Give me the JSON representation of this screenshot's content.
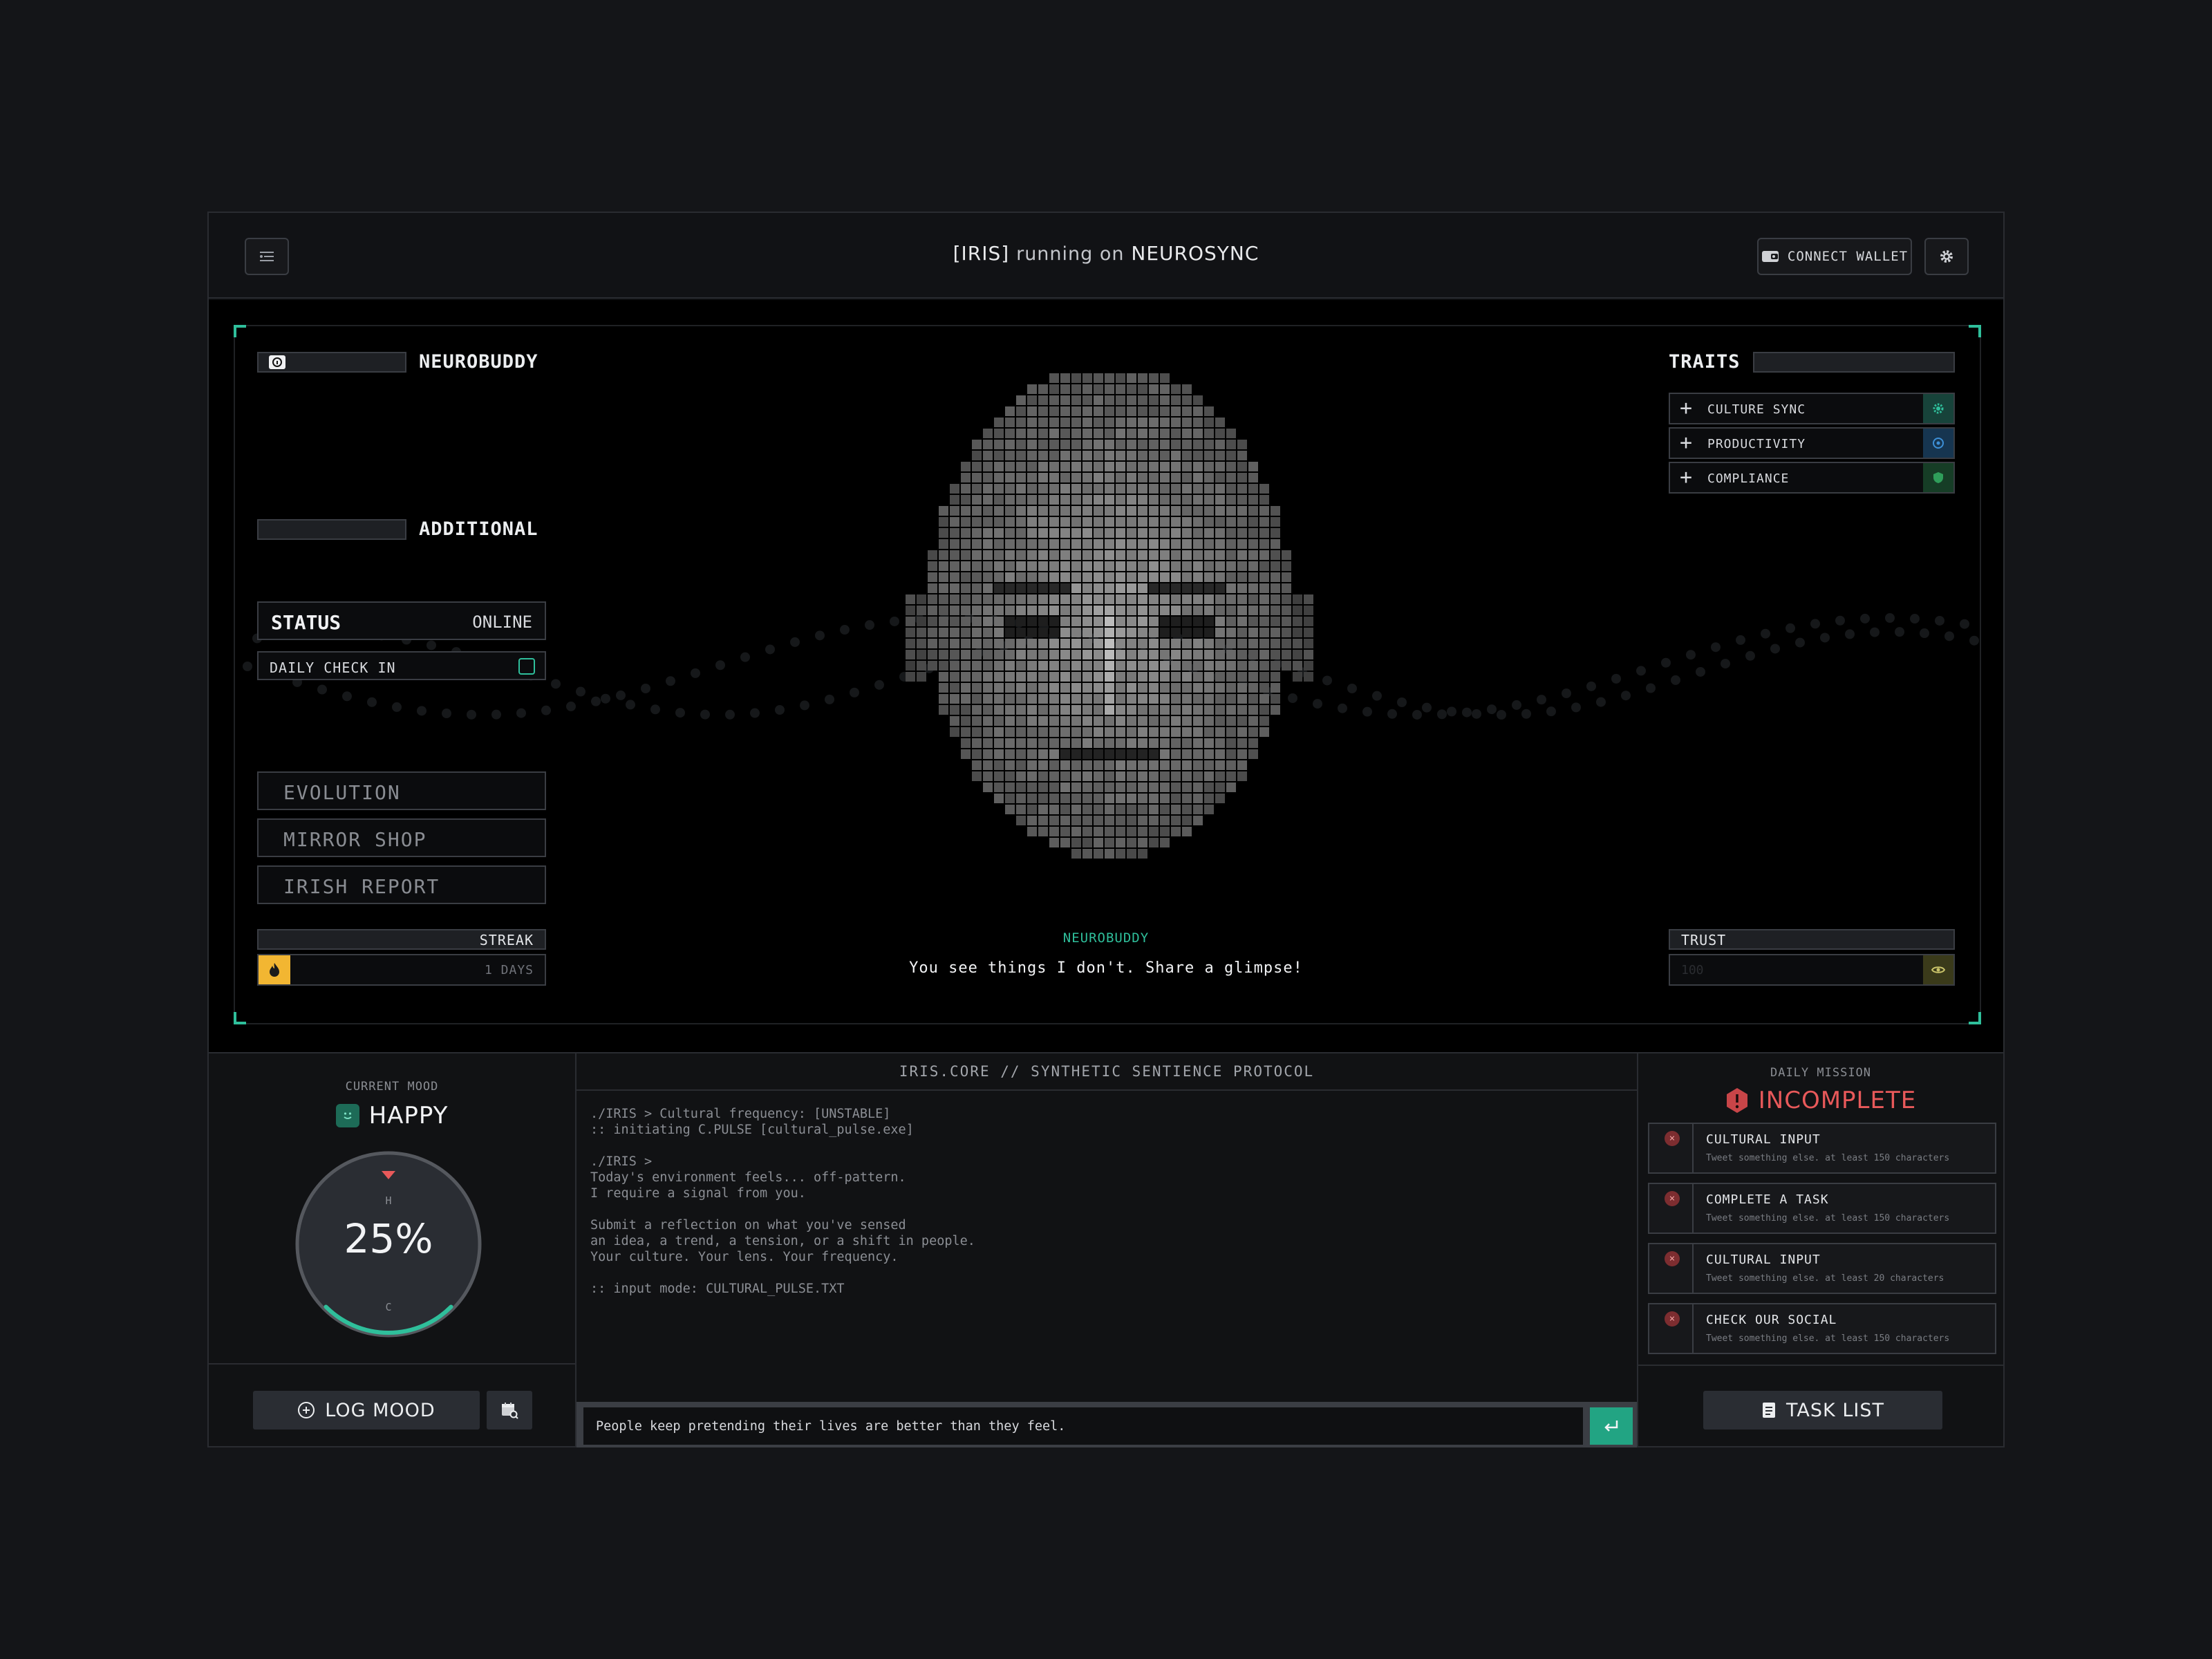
{
  "header": {
    "brand": "[IRIS]",
    "running": "running on",
    "platform": "NEUROSYNC",
    "connect_wallet": "CONNECT WALLET"
  },
  "left": {
    "section_title": "NEUROBUDDY",
    "status_label": "STATUS",
    "status_value": "ONLINE",
    "daily_check_in": "DAILY CHECK IN",
    "additional_title": "ADDITIONAL",
    "additional_items": [
      {
        "label": "EVOLUTION"
      },
      {
        "label": "MIRROR SHOP"
      },
      {
        "label": "IRISH REPORT"
      }
    ],
    "streak_label": "STREAK",
    "streak_value": "1 DAYS"
  },
  "right": {
    "traits_title": "TRAITS",
    "traits": [
      {
        "label": "CULTURE SYNC",
        "icon": "culture-sync-icon",
        "color": "#2fbf9b"
      },
      {
        "label": "PRODUCTIVITY",
        "icon": "productivity-icon",
        "color": "#3d8fd6"
      },
      {
        "label": "COMPLIANCE",
        "icon": "compliance-icon",
        "color": "#2f9e5a"
      }
    ],
    "trust_label": "TRUST",
    "trust_value": "100"
  },
  "center": {
    "speaker": "NEUROBUDDY",
    "message": "You see things I don't. Share a glimpse!"
  },
  "mood": {
    "caption": "CURRENT MOOD",
    "value": "HAPPY",
    "percent_text": "25%",
    "percent": 0.25,
    "top_label": "H",
    "bottom_label": "C",
    "log_button": "LOG MOOD",
    "accent": "#2fbf9b"
  },
  "terminal": {
    "title": "IRIS.CORE // SYNTHETIC SENTIENCE PROTOCOL",
    "lines": "./IRIS > Cultural frequency: [UNSTABLE]\n:: initiating C.PULSE [cultural_pulse.exe]\n\n./IRIS >\nToday's environment feels... off-pattern.\nI require a signal from you.\n\nSubmit a reflection on what you've sensed\nan idea, a trend, a tension, or a shift in people.\nYour culture. Your lens. Your frequency.\n\n:: input mode: CULTURAL_PULSE.TXT",
    "input_value": "People keep pretending their lives are better than they feel."
  },
  "mission": {
    "caption": "DAILY MISSION",
    "state": "INCOMPLETE",
    "state_color": "#e8595a",
    "tasks": [
      {
        "title": "CULTURAL INPUT",
        "desc": "Tweet something else. at least 150 characters"
      },
      {
        "title": "COMPLETE A TASK",
        "desc": "Tweet something else. at least 150 characters"
      },
      {
        "title": "CULTURAL INPUT",
        "desc": "Tweet something else. at least 20 characters"
      },
      {
        "title": "CHECK OUR SOCIAL",
        "desc": "Tweet something else. at least 150 characters"
      }
    ],
    "task_list_button": "TASK LIST"
  }
}
